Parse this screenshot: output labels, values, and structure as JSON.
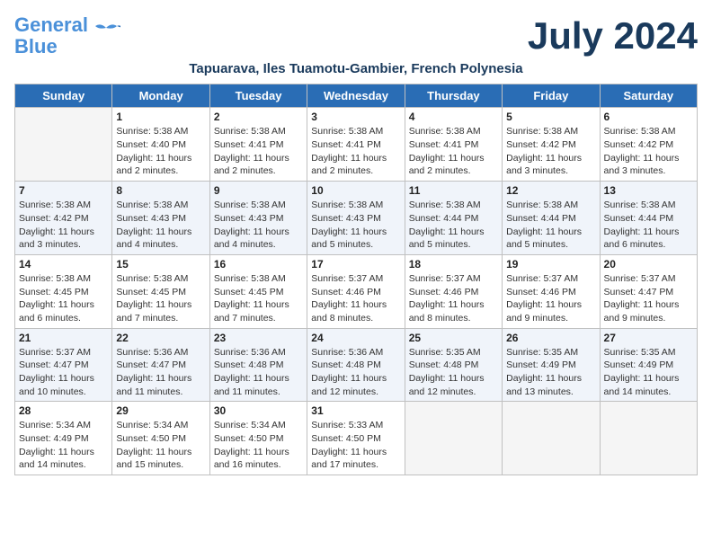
{
  "header": {
    "logo_line1": "General",
    "logo_line2": "Blue",
    "month_title": "July 2024",
    "subtitle": "Tapuarava, Iles Tuamotu-Gambier, French Polynesia"
  },
  "weekdays": [
    "Sunday",
    "Monday",
    "Tuesday",
    "Wednesday",
    "Thursday",
    "Friday",
    "Saturday"
  ],
  "weeks": [
    [
      {
        "num": "",
        "text": ""
      },
      {
        "num": "1",
        "text": "Sunrise: 5:38 AM\nSunset: 4:40 PM\nDaylight: 11 hours\nand 2 minutes."
      },
      {
        "num": "2",
        "text": "Sunrise: 5:38 AM\nSunset: 4:41 PM\nDaylight: 11 hours\nand 2 minutes."
      },
      {
        "num": "3",
        "text": "Sunrise: 5:38 AM\nSunset: 4:41 PM\nDaylight: 11 hours\nand 2 minutes."
      },
      {
        "num": "4",
        "text": "Sunrise: 5:38 AM\nSunset: 4:41 PM\nDaylight: 11 hours\nand 2 minutes."
      },
      {
        "num": "5",
        "text": "Sunrise: 5:38 AM\nSunset: 4:42 PM\nDaylight: 11 hours\nand 3 minutes."
      },
      {
        "num": "6",
        "text": "Sunrise: 5:38 AM\nSunset: 4:42 PM\nDaylight: 11 hours\nand 3 minutes."
      }
    ],
    [
      {
        "num": "7",
        "text": "Sunrise: 5:38 AM\nSunset: 4:42 PM\nDaylight: 11 hours\nand 3 minutes."
      },
      {
        "num": "8",
        "text": "Sunrise: 5:38 AM\nSunset: 4:43 PM\nDaylight: 11 hours\nand 4 minutes."
      },
      {
        "num": "9",
        "text": "Sunrise: 5:38 AM\nSunset: 4:43 PM\nDaylight: 11 hours\nand 4 minutes."
      },
      {
        "num": "10",
        "text": "Sunrise: 5:38 AM\nSunset: 4:43 PM\nDaylight: 11 hours\nand 5 minutes."
      },
      {
        "num": "11",
        "text": "Sunrise: 5:38 AM\nSunset: 4:44 PM\nDaylight: 11 hours\nand 5 minutes."
      },
      {
        "num": "12",
        "text": "Sunrise: 5:38 AM\nSunset: 4:44 PM\nDaylight: 11 hours\nand 5 minutes."
      },
      {
        "num": "13",
        "text": "Sunrise: 5:38 AM\nSunset: 4:44 PM\nDaylight: 11 hours\nand 6 minutes."
      }
    ],
    [
      {
        "num": "14",
        "text": "Sunrise: 5:38 AM\nSunset: 4:45 PM\nDaylight: 11 hours\nand 6 minutes."
      },
      {
        "num": "15",
        "text": "Sunrise: 5:38 AM\nSunset: 4:45 PM\nDaylight: 11 hours\nand 7 minutes."
      },
      {
        "num": "16",
        "text": "Sunrise: 5:38 AM\nSunset: 4:45 PM\nDaylight: 11 hours\nand 7 minutes."
      },
      {
        "num": "17",
        "text": "Sunrise: 5:37 AM\nSunset: 4:46 PM\nDaylight: 11 hours\nand 8 minutes."
      },
      {
        "num": "18",
        "text": "Sunrise: 5:37 AM\nSunset: 4:46 PM\nDaylight: 11 hours\nand 8 minutes."
      },
      {
        "num": "19",
        "text": "Sunrise: 5:37 AM\nSunset: 4:46 PM\nDaylight: 11 hours\nand 9 minutes."
      },
      {
        "num": "20",
        "text": "Sunrise: 5:37 AM\nSunset: 4:47 PM\nDaylight: 11 hours\nand 9 minutes."
      }
    ],
    [
      {
        "num": "21",
        "text": "Sunrise: 5:37 AM\nSunset: 4:47 PM\nDaylight: 11 hours\nand 10 minutes."
      },
      {
        "num": "22",
        "text": "Sunrise: 5:36 AM\nSunset: 4:47 PM\nDaylight: 11 hours\nand 11 minutes."
      },
      {
        "num": "23",
        "text": "Sunrise: 5:36 AM\nSunset: 4:48 PM\nDaylight: 11 hours\nand 11 minutes."
      },
      {
        "num": "24",
        "text": "Sunrise: 5:36 AM\nSunset: 4:48 PM\nDaylight: 11 hours\nand 12 minutes."
      },
      {
        "num": "25",
        "text": "Sunrise: 5:35 AM\nSunset: 4:48 PM\nDaylight: 11 hours\nand 12 minutes."
      },
      {
        "num": "26",
        "text": "Sunrise: 5:35 AM\nSunset: 4:49 PM\nDaylight: 11 hours\nand 13 minutes."
      },
      {
        "num": "27",
        "text": "Sunrise: 5:35 AM\nSunset: 4:49 PM\nDaylight: 11 hours\nand 14 minutes."
      }
    ],
    [
      {
        "num": "28",
        "text": "Sunrise: 5:34 AM\nSunset: 4:49 PM\nDaylight: 11 hours\nand 14 minutes."
      },
      {
        "num": "29",
        "text": "Sunrise: 5:34 AM\nSunset: 4:50 PM\nDaylight: 11 hours\nand 15 minutes."
      },
      {
        "num": "30",
        "text": "Sunrise: 5:34 AM\nSunset: 4:50 PM\nDaylight: 11 hours\nand 16 minutes."
      },
      {
        "num": "31",
        "text": "Sunrise: 5:33 AM\nSunset: 4:50 PM\nDaylight: 11 hours\nand 17 minutes."
      },
      {
        "num": "",
        "text": ""
      },
      {
        "num": "",
        "text": ""
      },
      {
        "num": "",
        "text": ""
      }
    ]
  ]
}
